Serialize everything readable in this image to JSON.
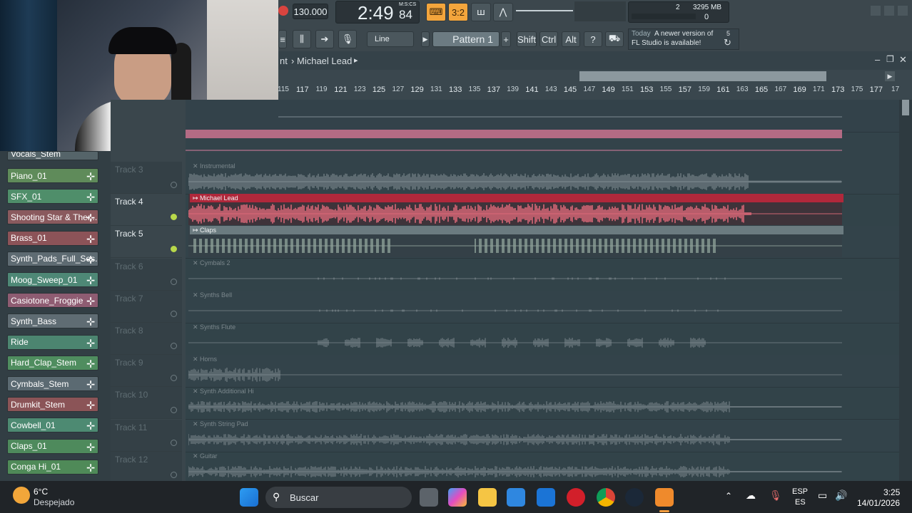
{
  "toolbar": {
    "tempo": "130.000",
    "time_main": "2:49",
    "time_sub": "84",
    "time_unit": "M:S:CS",
    "pattern_label": "Pattern 1",
    "snap_label": "Line",
    "modifier_keys": [
      "Shift",
      "Ctrl",
      "Alt"
    ],
    "cpu_value": "2",
    "ram_value": "3295 MB",
    "voices_value": "0",
    "news_day": "Today",
    "news_text_line1": "A newer version of",
    "news_text_line2": "FL Studio is available!",
    "news_count": "5"
  },
  "playlist": {
    "breadcrumb_prefix": "nt",
    "breadcrumb_current": "Michael Lead",
    "ruler_ticks": [
      "115",
      "117",
      "119",
      "121",
      "123",
      "125",
      "127",
      "129",
      "131",
      "133",
      "135",
      "137",
      "139",
      "141",
      "143",
      "145",
      "147",
      "149",
      "151",
      "153",
      "155",
      "157",
      "159",
      "161",
      "163",
      "165",
      "167",
      "169",
      "171",
      "173",
      "175",
      "177",
      "17"
    ]
  },
  "browser": {
    "items": [
      {
        "label": "Piano_01",
        "color": "#5f8b5a"
      },
      {
        "label": "SFX_01",
        "color": "#4f8e6a"
      },
      {
        "label": "Shooting Star & Ther...",
        "color": "#8a5a5e"
      },
      {
        "label": "Brass_01",
        "color": "#8c5358"
      },
      {
        "label": "Synth_Pads_Full_Ses...",
        "color": "#5e6b72"
      },
      {
        "label": "Moog_Sweep_01",
        "color": "#4e8876"
      },
      {
        "label": "Casiotone_Froggie",
        "color": "#8e5c72"
      },
      {
        "label": "Synth_Bass",
        "color": "#5f6c73"
      },
      {
        "label": "Ride",
        "color": "#4c8570"
      },
      {
        "label": "Hard_Clap_Stem",
        "color": "#4f8d5f"
      },
      {
        "label": "Cymbals_Stem",
        "color": "#5b6a72"
      },
      {
        "label": "Drumkit_Stem",
        "color": "#8b5457"
      },
      {
        "label": "Cowbell_01",
        "color": "#4d8a72"
      },
      {
        "label": "Claps_01",
        "color": "#4e8a5c"
      },
      {
        "label": "Conga Hi_01",
        "color": "#4f8a58"
      }
    ],
    "partial_top": "Vocals_Stem"
  },
  "tracks": [
    {
      "name": "Track 3",
      "clip": "Instrumental",
      "active": false,
      "color": "#9aa5aa"
    },
    {
      "name": "Track 4",
      "clip": "Michael Lead",
      "active": true,
      "color": "#e06a7a"
    },
    {
      "name": "Track 5",
      "clip": "Claps",
      "active": true,
      "color": "#8fa29a"
    },
    {
      "name": "Track 6",
      "clip": "Cymbals 2",
      "active": false,
      "color": "#8d989d"
    },
    {
      "name": "Track 7",
      "clip": "Synths Bell",
      "active": false,
      "color": "#8d989d"
    },
    {
      "name": "Track 8",
      "clip": "Synths Flute",
      "active": false,
      "color": "#8d989d"
    },
    {
      "name": "Track 9",
      "clip": "Horns",
      "active": false,
      "color": "#8d989d"
    },
    {
      "name": "Track 10",
      "clip": "Synth Additional Hi",
      "active": false,
      "color": "#8d989d"
    },
    {
      "name": "Track 11",
      "clip": "Synth String Pad",
      "active": false,
      "color": "#8d989d"
    },
    {
      "name": "Track 12",
      "clip": "Guitar",
      "active": false,
      "color": "#8d989d"
    }
  ],
  "taskbar": {
    "weather_temp": "6°C",
    "weather_desc": "Despejado",
    "search_placeholder": "Buscar",
    "lang_top": "ESP",
    "lang_bottom": "ES",
    "clock_time": "3:25",
    "clock_date": "14/01/2026"
  }
}
